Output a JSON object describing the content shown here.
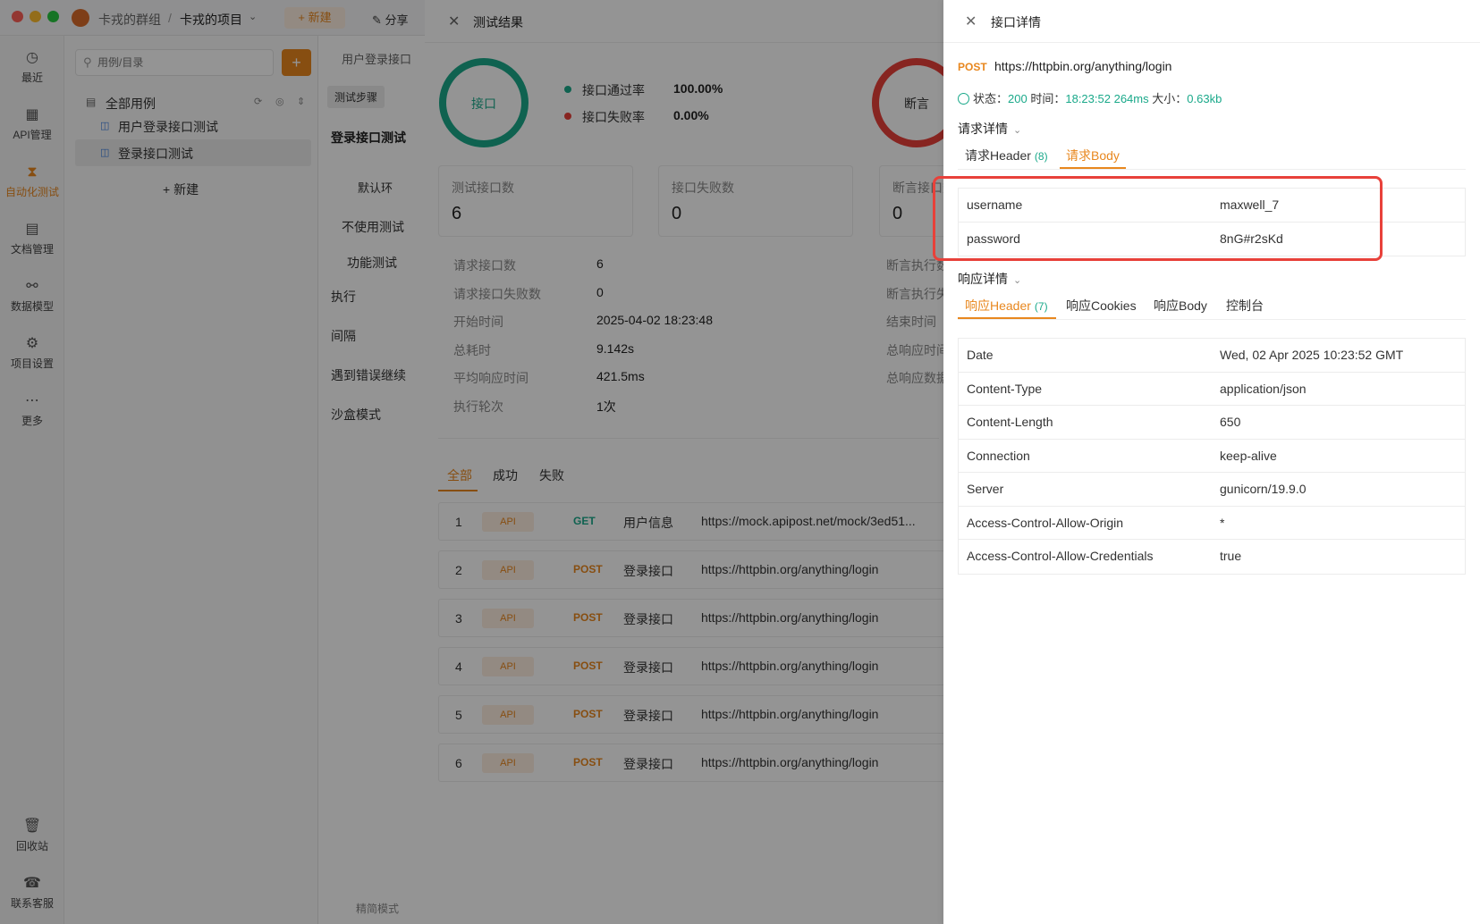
{
  "titlebar": {
    "workspace": "卡戎的群组",
    "separator": "/",
    "project": "卡戎的项目",
    "new_label": "新建",
    "share_label": "分享"
  },
  "nav": {
    "items": [
      {
        "label": "最近"
      },
      {
        "label": "API管理"
      },
      {
        "label": "自动化测试"
      },
      {
        "label": "文档管理"
      },
      {
        "label": "数据模型"
      },
      {
        "label": "项目设置"
      },
      {
        "label": "更多"
      }
    ],
    "bottom": [
      {
        "label": "回收站"
      },
      {
        "label": "联系客服"
      }
    ]
  },
  "tree": {
    "search_placeholder": "用例/目录",
    "root_label": "全部用例",
    "items": [
      "用户登录接口测试",
      "登录接口测试"
    ],
    "new_label": "新建"
  },
  "main": {
    "breadcrumb": "用户登录接口",
    "tab_steps": "测试步骤",
    "case_title": "登录接口测试",
    "env_label": "默认环",
    "no_use_label": "不使用测试",
    "func_test_label": "功能测试",
    "exec_label": "执行",
    "interval_label": "间隔",
    "on_error_label": "遇到错误继续",
    "sandbox_label": "沙盒模式",
    "simple_mode_label": "精简模式"
  },
  "result": {
    "title": "测试结果",
    "ring_label": "接口",
    "assert_ring_label": "断言",
    "pass_rate_label": "接口通过率",
    "pass_rate": "100.00%",
    "fail_rate_label": "接口失败率",
    "fail_rate": "0.00%",
    "cards": [
      {
        "label": "测试接口数",
        "value": "6"
      },
      {
        "label": "接口失败数",
        "value": "0"
      },
      {
        "label": "断言接口数",
        "value": "0"
      }
    ],
    "stats": [
      {
        "label": "请求接口数",
        "value": "6"
      },
      {
        "label": "请求接口失败数",
        "value": "0"
      },
      {
        "label": "开始时间",
        "value": "2025-04-02 18:23:48"
      },
      {
        "label": "总耗时",
        "value": "9.142s"
      },
      {
        "label": "平均响应时间",
        "value": "421.5ms"
      },
      {
        "label": "执行轮次",
        "value": "1次"
      }
    ],
    "stats_right": [
      "断言执行数",
      "断言执行失败数",
      "结束时间",
      "总响应时间",
      "总响应数据"
    ],
    "tabs": [
      "全部",
      "成功",
      "失败"
    ],
    "rows": [
      {
        "idx": "1",
        "tag": "API",
        "method": "GET",
        "name": "用户信息",
        "url": "https://mock.apipost.net/mock/3ed51..."
      },
      {
        "idx": "2",
        "tag": "API",
        "method": "POST",
        "name": "登录接口",
        "url": "https://httpbin.org/anything/login"
      },
      {
        "idx": "3",
        "tag": "API",
        "method": "POST",
        "name": "登录接口",
        "url": "https://httpbin.org/anything/login"
      },
      {
        "idx": "4",
        "tag": "API",
        "method": "POST",
        "name": "登录接口",
        "url": "https://httpbin.org/anything/login"
      },
      {
        "idx": "5",
        "tag": "API",
        "method": "POST",
        "name": "登录接口",
        "url": "https://httpbin.org/anything/login"
      },
      {
        "idx": "6",
        "tag": "API",
        "method": "POST",
        "name": "登录接口",
        "url": "https://httpbin.org/anything/login"
      }
    ]
  },
  "detail": {
    "title": "接口详情",
    "method": "POST",
    "url": "https://httpbin.org/anything/login",
    "status_label": "状态：",
    "status": "200",
    "time_label": "时间：",
    "time": "18:23:52",
    "duration": "264ms",
    "size_label": "大小：",
    "size": "0.63kb",
    "request_title": "请求详情",
    "request_tabs": [
      {
        "label": "请求Header",
        "count": "(8)"
      },
      {
        "label": "请求Body",
        "count": ""
      }
    ],
    "request_body": [
      {
        "key": "username",
        "value": "maxwell_7"
      },
      {
        "key": "password",
        "value": "8nG#r2sKd"
      }
    ],
    "response_title": "响应详情",
    "response_tabs": [
      {
        "label": "响应Header",
        "count": "(7)"
      },
      {
        "label": "响应Cookies",
        "count": ""
      },
      {
        "label": "响应Body",
        "count": ""
      },
      {
        "label": "控制台",
        "count": ""
      }
    ],
    "response_headers": [
      {
        "key": "Date",
        "value": "Wed, 02 Apr 2025 10:23:52 GMT"
      },
      {
        "key": "Content-Type",
        "value": "application/json"
      },
      {
        "key": "Content-Length",
        "value": "650"
      },
      {
        "key": "Connection",
        "value": "keep-alive"
      },
      {
        "key": "Server",
        "value": "gunicorn/19.9.0"
      },
      {
        "key": "Access-Control-Allow-Origin",
        "value": "*"
      },
      {
        "key": "Access-Control-Allow-Credentials",
        "value": "true"
      }
    ]
  },
  "colors": {
    "accent": "#e8871e",
    "success": "#1aa98a",
    "danger": "#e8413a",
    "get": "#1aa98a"
  }
}
